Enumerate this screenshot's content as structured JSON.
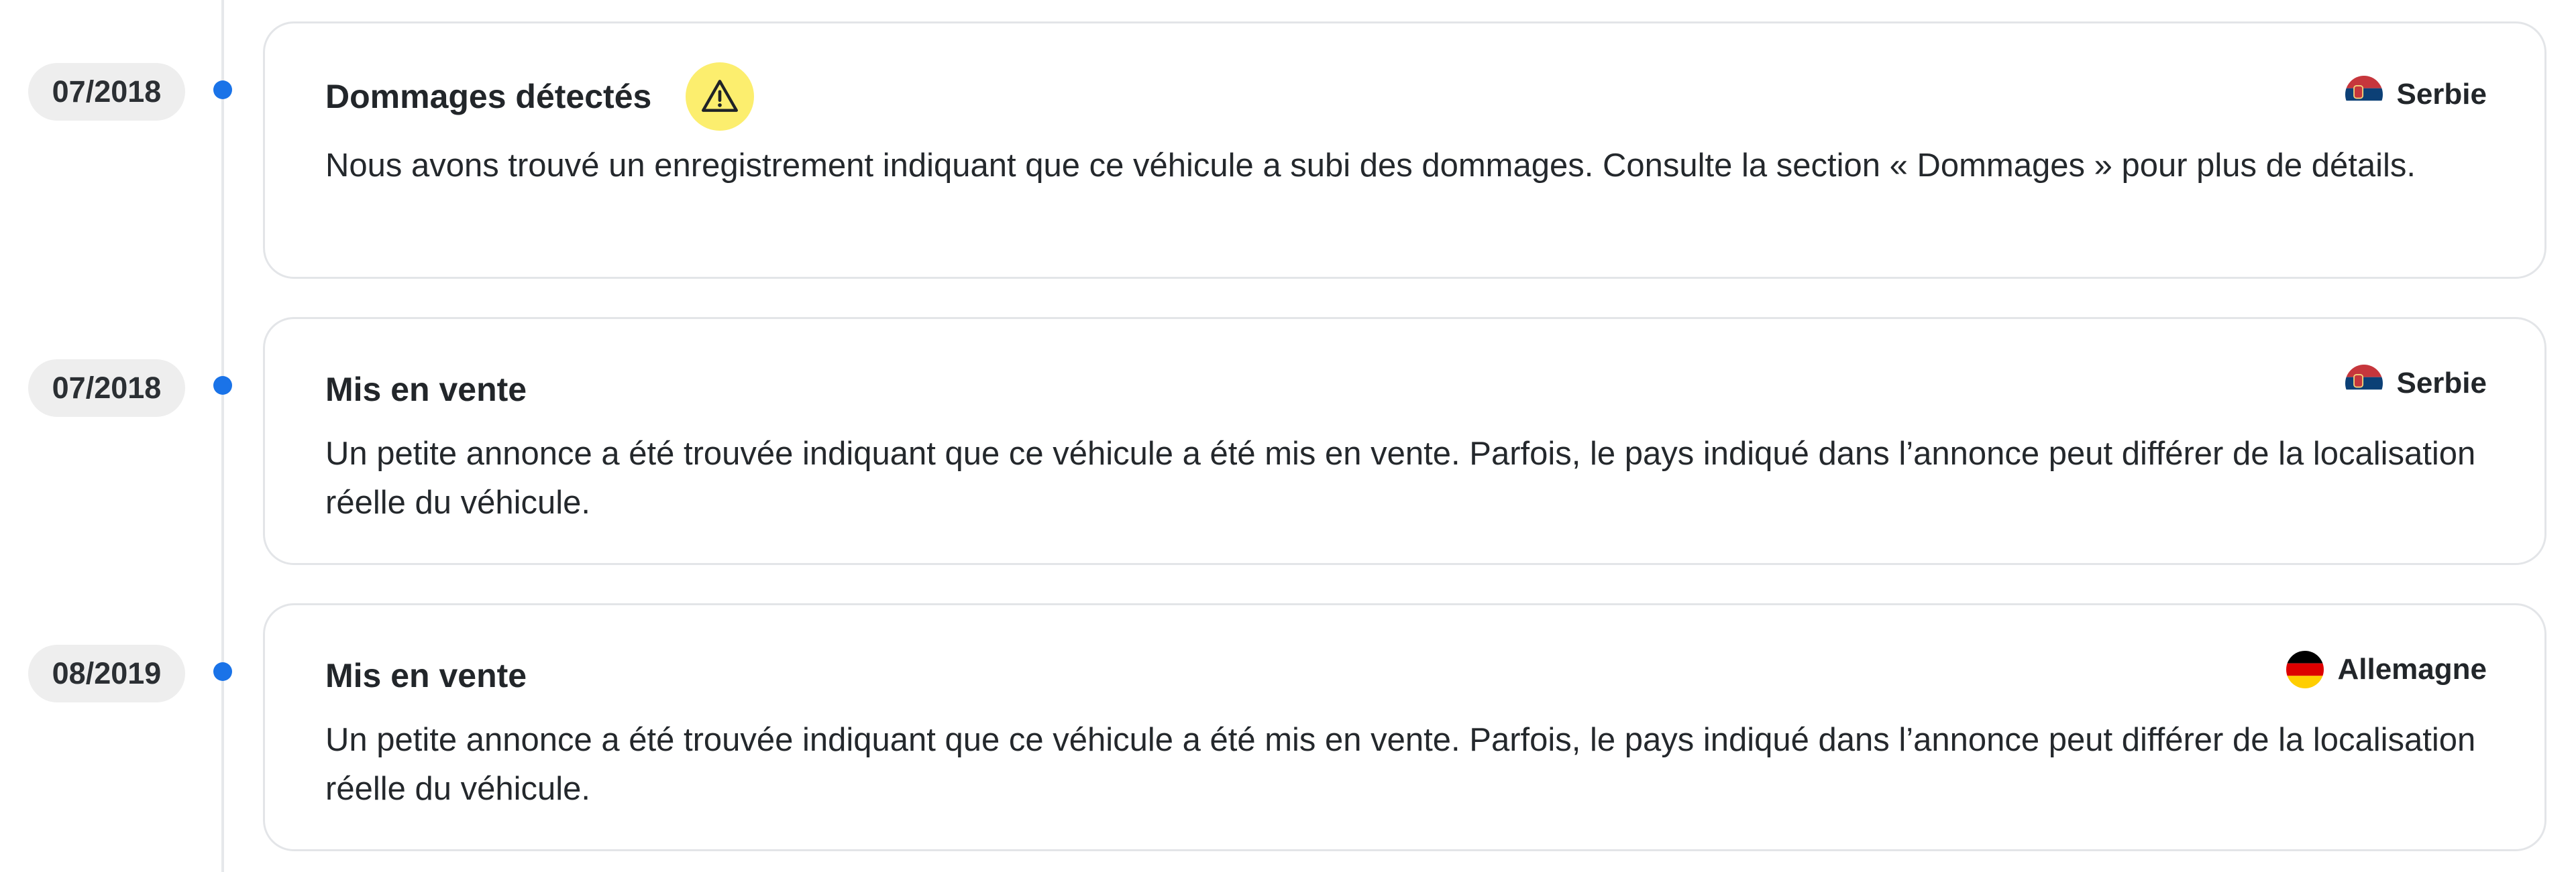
{
  "entries": [
    {
      "date": "07/2018",
      "title": "Dommages détectés",
      "warning_icon": "warning-triangle-icon",
      "country": "Serbie",
      "flag": "serbia-flag-icon",
      "description": "Nous avons trouvé un enregistrement indiquant que ce véhicule a subi des dommages. Consulte la section « Dommages » pour plus de détails."
    },
    {
      "date": "07/2018",
      "title": "Mis en vente",
      "country": "Serbie",
      "flag": "serbia-flag-icon",
      "description": "Un petite annonce a été trouvée indiquant que ce véhicule a été mis en vente. Parfois, le pays indiqué dans l’annonce peut différer de la localisation réelle du véhicule."
    },
    {
      "date": "08/2019",
      "title": "Mis en vente",
      "country": "Allemagne",
      "flag": "germany-flag-icon",
      "description": "Un petite annonce a été trouvée indiquant que ce véhicule a été mis en vente. Parfois, le pays indiqué dans l’annonce peut différer de la localisation réelle du véhicule."
    }
  ],
  "colors": {
    "timeline_dot": "#1a73e8",
    "warning_badge": "#fcee6e",
    "date_pill_bg": "#eeeeee",
    "card_border": "#e3e5e8"
  }
}
